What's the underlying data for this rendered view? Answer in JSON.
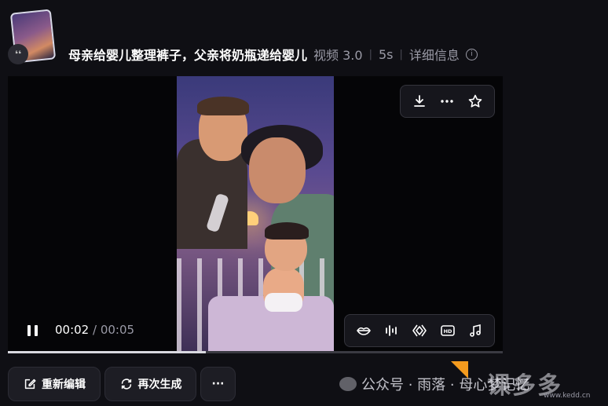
{
  "header": {
    "title": "母亲给婴儿整理裤子，父亲将奶瓶递给婴儿",
    "model": "视频 3.0",
    "duration": "5s",
    "details_label": "详细信息",
    "thumb_badge": "❛❛"
  },
  "player": {
    "current_time": "00:02",
    "separator": " / ",
    "total_time": "00:05",
    "progress": 0.4
  },
  "top_toolbar": {
    "icons": [
      "download-icon",
      "more-icon",
      "star-icon"
    ]
  },
  "bottom_toolbar": {
    "icons": [
      "lip-sync-icon",
      "audio-wave-icon",
      "frames-icon",
      "hd-icon",
      "music-icon"
    ],
    "hd_text": "HD"
  },
  "actions": {
    "reedit_label": "重新编辑",
    "regenerate_label": "再次生成",
    "more_label": "···"
  },
  "watermark": {
    "text": "公众号 · 雨落 · 母心梦记忆",
    "brand": "课多多",
    "url": "www.kedd.cn"
  },
  "colors": {
    "background": "#0f0f14",
    "panel": "#1d1d24",
    "accent": "#f39a1e"
  }
}
